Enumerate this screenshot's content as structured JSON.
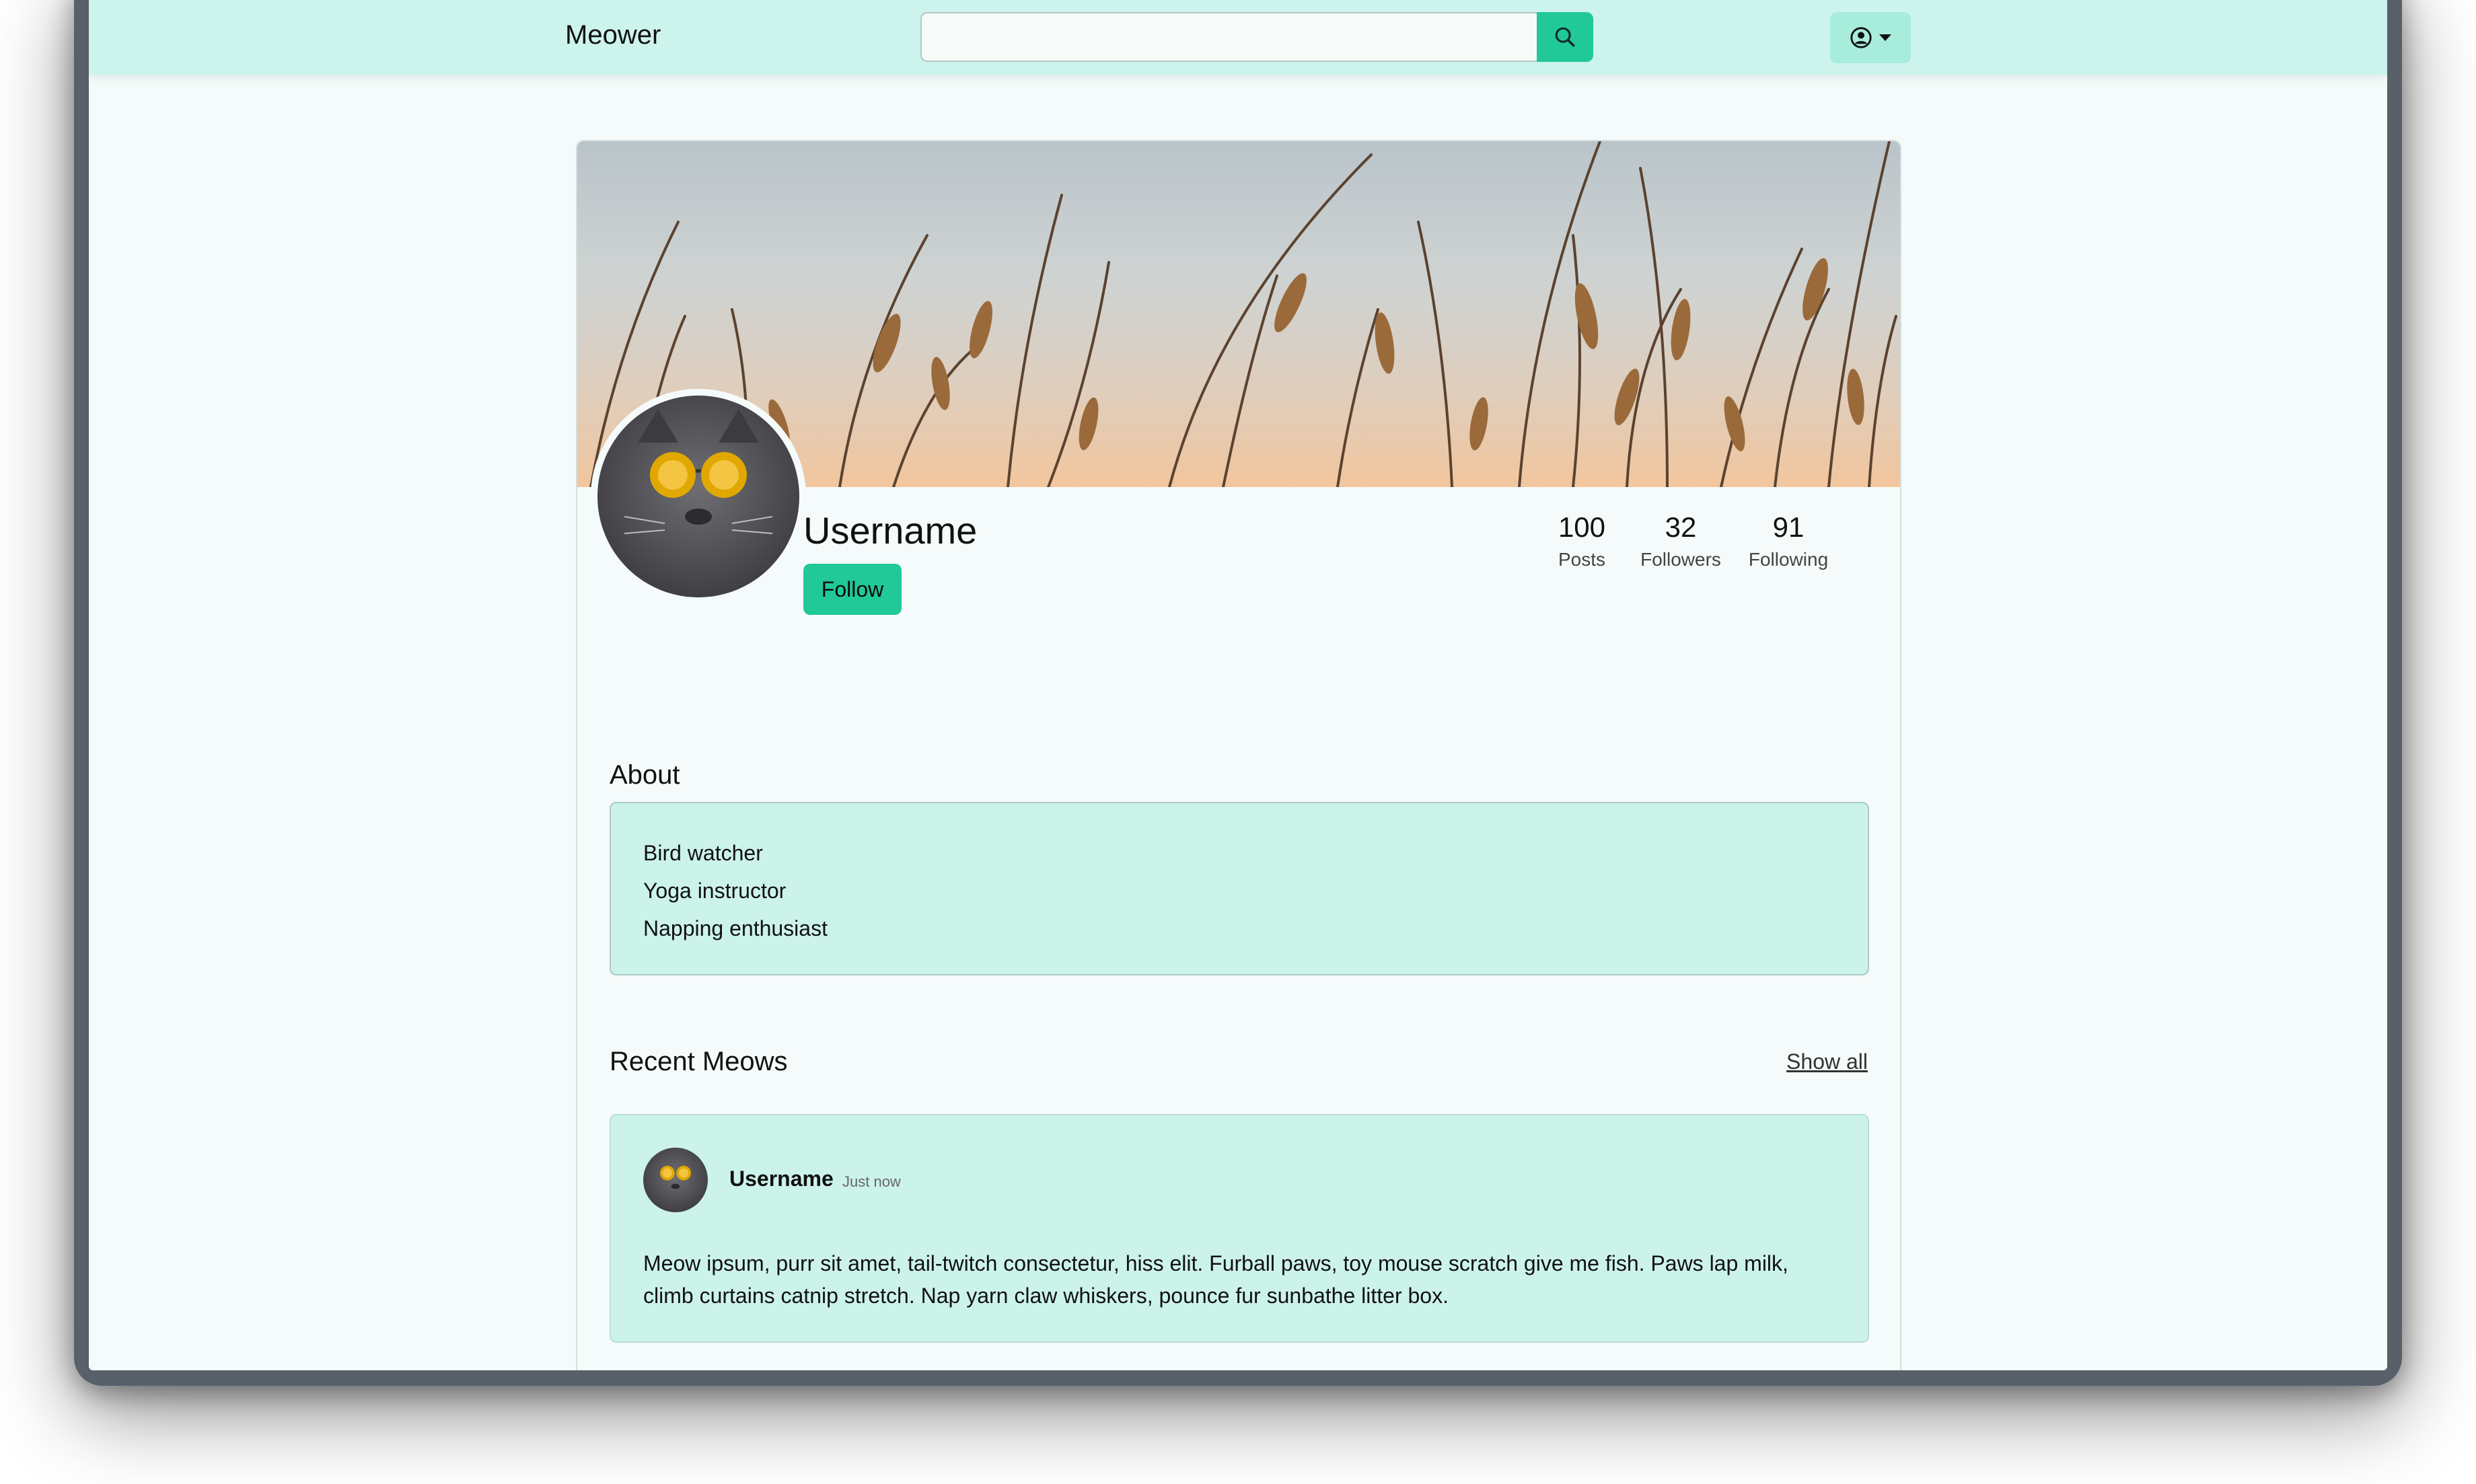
{
  "navbar": {
    "brand": "Meower",
    "search_placeholder": "",
    "search_icon": "search-icon",
    "user_icon": "user-circle-icon",
    "accent_color": "#20c997"
  },
  "profile": {
    "username": "Username",
    "follow_label": "Follow",
    "stats": [
      {
        "value": "100",
        "label": "Posts"
      },
      {
        "value": "32",
        "label": "Followers"
      },
      {
        "value": "91",
        "label": "Following"
      }
    ]
  },
  "about": {
    "title": "About",
    "lines": [
      "Bird watcher",
      "Yoga instructor",
      "Napping enthusiast"
    ]
  },
  "recent": {
    "title": "Recent Meows",
    "show_all": "Show all",
    "posts": [
      {
        "username": "Username",
        "time": "Just now",
        "text": "Meow ipsum, purr sit amet, tail-twitch consectetur, hiss elit. Furball paws, toy mouse scratch give me fish. Paws lap milk, climb curtains catnip stretch. Nap yarn claw whiskers, pounce fur sunbathe litter box."
      }
    ]
  }
}
